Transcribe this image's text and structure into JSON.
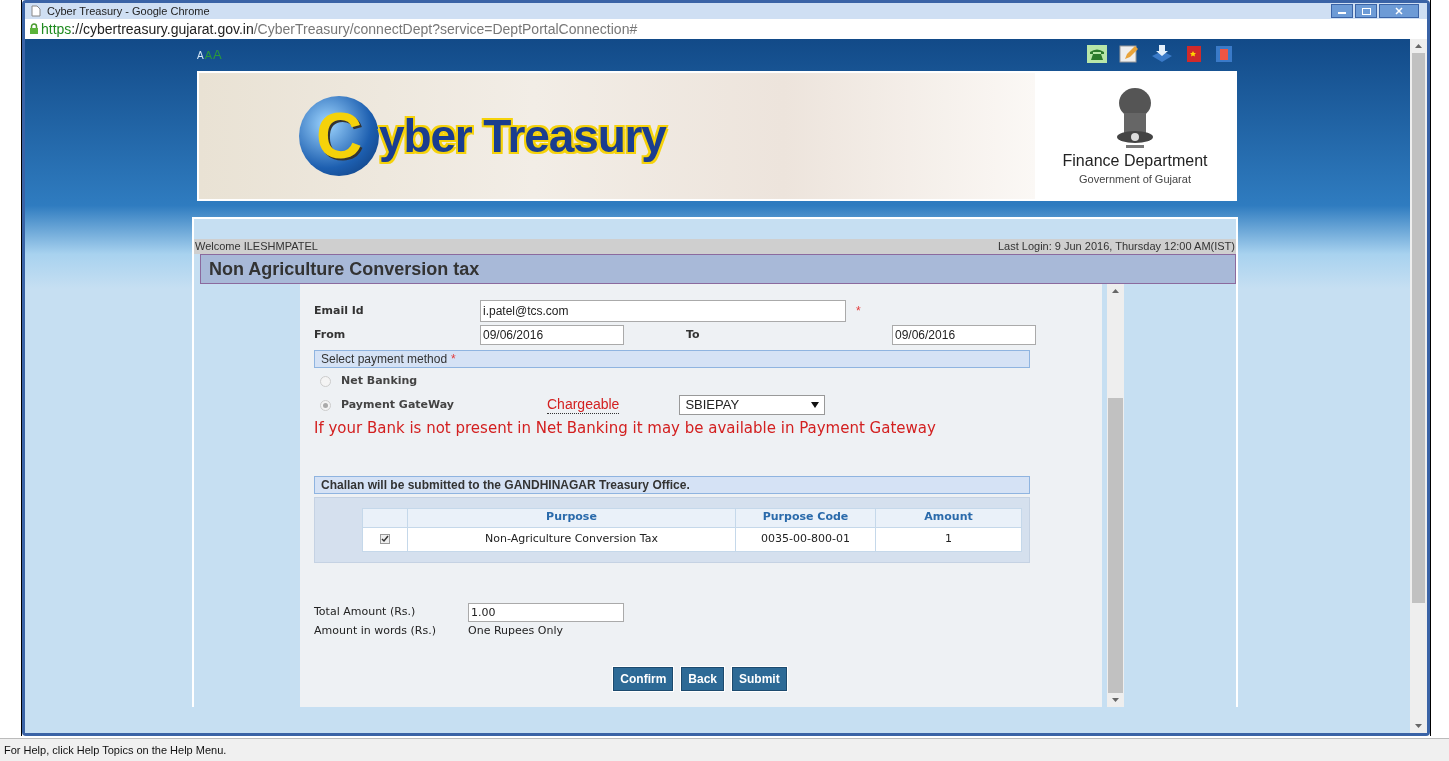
{
  "window": {
    "title": "Cyber Treasury - Google Chrome"
  },
  "address_bar": {
    "scheme": "https",
    "domain": "://cybertreasury.gujarat.gov.in",
    "path": "/CyberTreasury/connectDept?service=DeptPortalConnection#"
  },
  "font_size_links": [
    "A",
    "A",
    "A"
  ],
  "banner": {
    "logo_text": "yber Treasury",
    "logo_initial": "C",
    "department": "Finance Department",
    "government": "Government of Gujarat"
  },
  "welcome": "Welcome ILESHMPATEL",
  "last_login": "Last Login: 9 Jun 2016, Thursday 12:00 AM(IST)",
  "page_title": "Non Agriculture Conversion tax",
  "form": {
    "email": {
      "label": "Email Id",
      "value": "i.patel@tcs.com",
      "required_mark": "*"
    },
    "from": {
      "label": "From",
      "value": "09/06/2016"
    },
    "to": {
      "label": "To",
      "value": "09/06/2016"
    }
  },
  "payment": {
    "title": "Select payment method",
    "required_mark": "*",
    "options": [
      {
        "label": "Net Banking",
        "selected": false
      },
      {
        "label": "Payment GateWay",
        "selected": true
      }
    ],
    "chargeable": "Chargeable",
    "gateway": "SBIEPAY",
    "note": "If your Bank is not present in Net Banking it may be available in Payment Gateway"
  },
  "challan_note": "Challan will be submitted to the GANDHINAGAR Treasury Office.",
  "table": {
    "columns": [
      "Purpose",
      "Purpose Code",
      "Amount"
    ],
    "rows": [
      {
        "checked": true,
        "purpose": "Non-Agriculture Conversion Tax",
        "code": "0035-00-800-01",
        "amount": "1"
      }
    ]
  },
  "total": {
    "label": "Total Amount (Rs.)",
    "value": "1.00"
  },
  "words": {
    "label": "Amount in words (Rs.)",
    "value": "One Rupees Only"
  },
  "buttons": [
    "Confirm",
    "Back",
    "Submit"
  ],
  "status_bar": "For Help, click Help Topics on the Help Menu."
}
